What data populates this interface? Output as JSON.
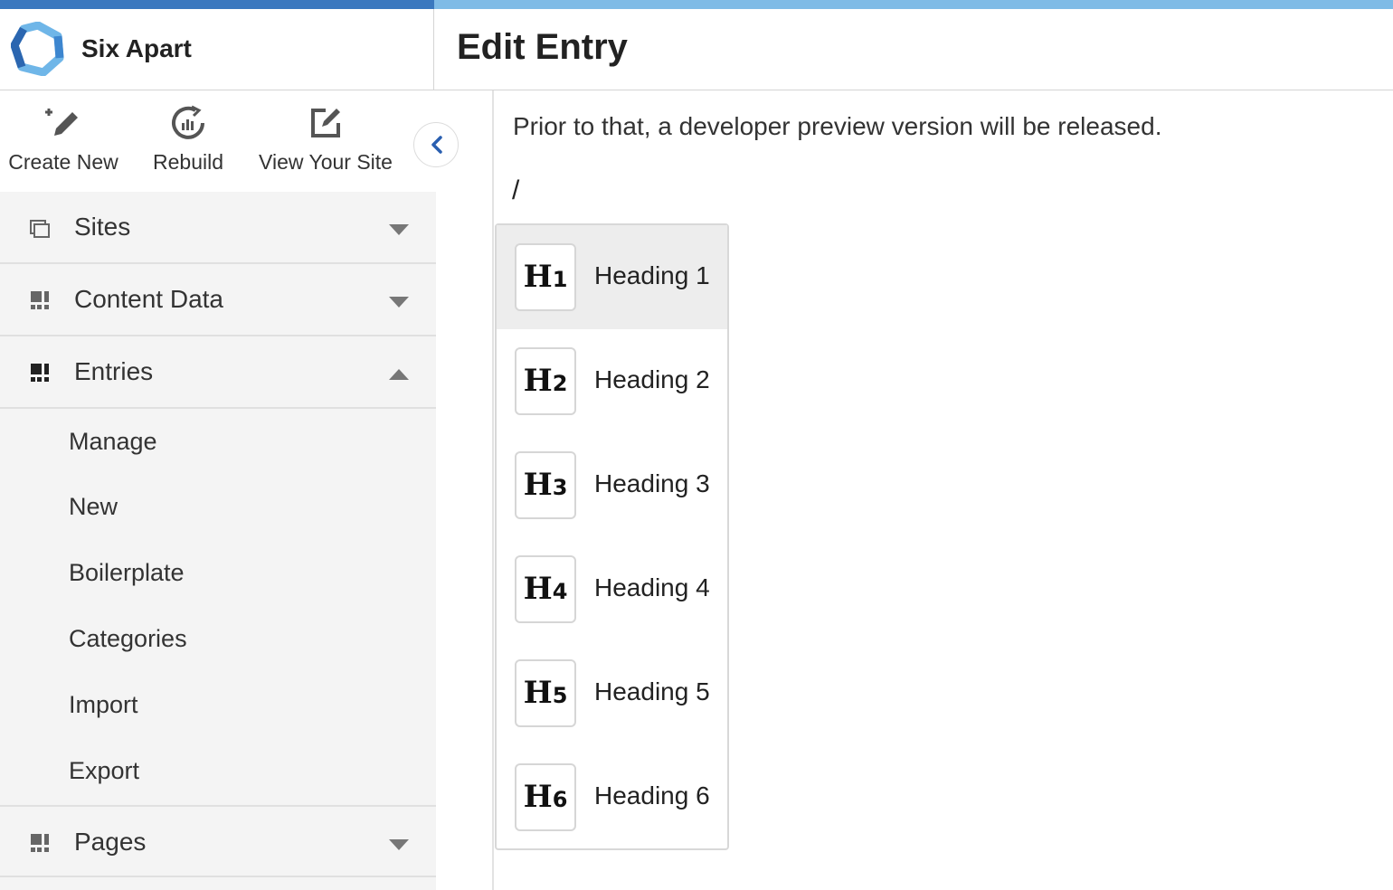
{
  "brand": {
    "name": "Six Apart"
  },
  "header": {
    "title": "Edit Entry"
  },
  "quick_actions": [
    {
      "label": "Create New",
      "icon": "pencil-sparkle-icon"
    },
    {
      "label": "Rebuild",
      "icon": "rebuild-chart-icon"
    },
    {
      "label": "View Your Site",
      "icon": "external-edit-icon"
    }
  ],
  "sidebar": {
    "sections": [
      {
        "label": "Sites",
        "icon": "sites-icon",
        "state": "collapsed"
      },
      {
        "label": "Content Data",
        "icon": "content-data-icon",
        "state": "collapsed"
      },
      {
        "label": "Entries",
        "icon": "entries-icon",
        "state": "expanded"
      },
      {
        "label": "Pages",
        "icon": "pages-icon",
        "state": "collapsed"
      }
    ],
    "entries_items": [
      "Manage",
      "New",
      "Boilerplate",
      "Categories",
      "Import",
      "Export"
    ]
  },
  "editor": {
    "paragraph": "Prior to that, a developer preview version will be released.",
    "slash_input": "/"
  },
  "block_menu": {
    "items": [
      {
        "badge": "H",
        "level": "1",
        "label": "Heading 1"
      },
      {
        "badge": "H",
        "level": "2",
        "label": "Heading 2"
      },
      {
        "badge": "H",
        "level": "3",
        "label": "Heading 3"
      },
      {
        "badge": "H",
        "level": "4",
        "label": "Heading 4"
      },
      {
        "badge": "H",
        "level": "5",
        "label": "Heading 5"
      },
      {
        "badge": "H",
        "level": "6",
        "label": "Heading 6"
      }
    ]
  },
  "colors": {
    "accent_dark": "#3a78bf",
    "accent_light": "#7fbbe6",
    "collapse_chevron": "#2a5fb0"
  }
}
